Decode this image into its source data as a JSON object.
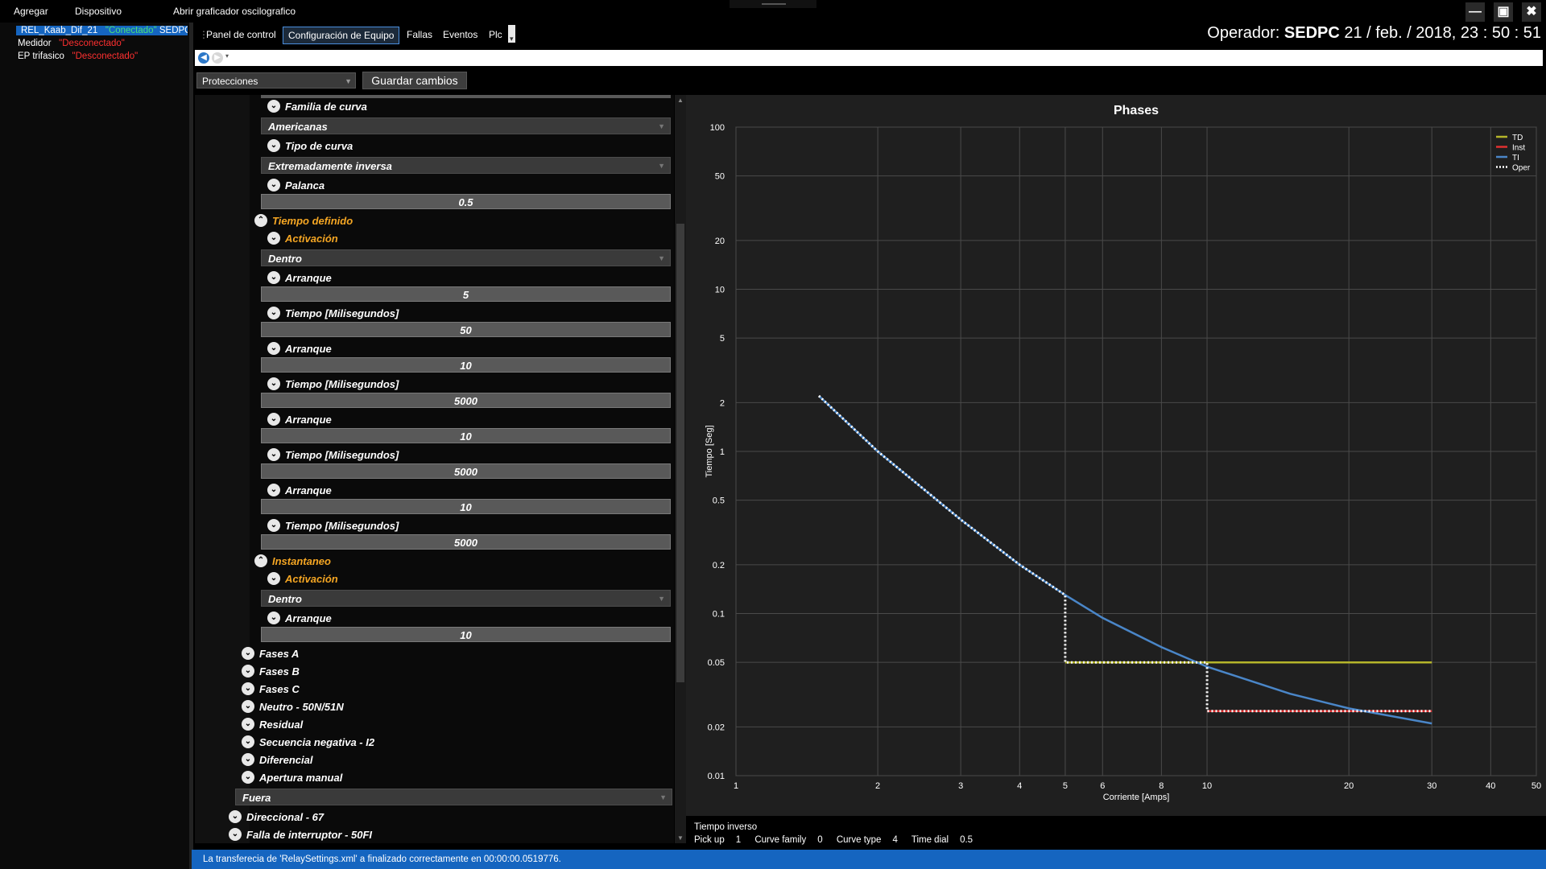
{
  "menu": {
    "items": [
      "Agregar",
      "Dispositivo",
      "Abrir graficador oscilografico"
    ]
  },
  "window_controls": {
    "minimize": "—",
    "maximize": "▣",
    "close": "✖"
  },
  "devices": [
    {
      "name": "REL_Kaab_Dif_21",
      "status": "\"Conectado\"",
      "extra": "SEDPC",
      "selected": true
    },
    {
      "name": "Medidor",
      "status": "\"Desconectado\"",
      "extra": "",
      "selected": false
    },
    {
      "name": "EP trifasico",
      "status": "\"Desconectado\"",
      "extra": "",
      "selected": false
    }
  ],
  "tabs": [
    {
      "label": "Panel de control",
      "active": false
    },
    {
      "label": "Configuración de Equipo",
      "active": true
    },
    {
      "label": "Fallas",
      "active": false
    },
    {
      "label": "Eventos",
      "active": false
    },
    {
      "label": "Plc",
      "active": false
    }
  ],
  "operator": {
    "label": "Operador:",
    "name": "SEDPC",
    "datetime": "21 / feb. / 2018, 23 : 50 : 51"
  },
  "toolbar": {
    "section_select": "Protecciones",
    "save_label": "Guardar cambios"
  },
  "settings": [
    {
      "type": "header",
      "text": "Familia de curva",
      "indent": 3,
      "orange": false,
      "icon": "chevron-down"
    },
    {
      "type": "combo",
      "value": "Americanas"
    },
    {
      "type": "header",
      "text": "Tipo de curva",
      "indent": 3,
      "orange": false,
      "icon": "chevron-down"
    },
    {
      "type": "combo",
      "value": "Extremadamente inversa"
    },
    {
      "type": "header",
      "text": "Palanca",
      "indent": 3,
      "orange": false,
      "icon": "chevron-down"
    },
    {
      "type": "value",
      "value": "0.5"
    },
    {
      "type": "header",
      "text": "Tiempo definido",
      "indent": 2,
      "orange": true,
      "icon": "chevron-up"
    },
    {
      "type": "header",
      "text": "Activación",
      "indent": 3,
      "orange": true,
      "icon": "chevron-down"
    },
    {
      "type": "combo",
      "value": "Dentro"
    },
    {
      "type": "header",
      "text": "Arranque",
      "indent": 3,
      "orange": false,
      "icon": "chevron-down"
    },
    {
      "type": "value",
      "value": "5"
    },
    {
      "type": "header",
      "text": "Tiempo [Milisegundos]",
      "indent": 3,
      "orange": false,
      "icon": "chevron-down"
    },
    {
      "type": "value",
      "value": "50"
    },
    {
      "type": "header",
      "text": "Arranque",
      "indent": 3,
      "orange": false,
      "icon": "chevron-down"
    },
    {
      "type": "value",
      "value": "10"
    },
    {
      "type": "header",
      "text": "Tiempo [Milisegundos]",
      "indent": 3,
      "orange": false,
      "icon": "chevron-down"
    },
    {
      "type": "value",
      "value": "5000"
    },
    {
      "type": "header",
      "text": "Arranque",
      "indent": 3,
      "orange": false,
      "icon": "chevron-down"
    },
    {
      "type": "value",
      "value": "10"
    },
    {
      "type": "header",
      "text": "Tiempo [Milisegundos]",
      "indent": 3,
      "orange": false,
      "icon": "chevron-down"
    },
    {
      "type": "value",
      "value": "5000"
    },
    {
      "type": "header",
      "text": "Arranque",
      "indent": 3,
      "orange": false,
      "icon": "chevron-down"
    },
    {
      "type": "value",
      "value": "10"
    },
    {
      "type": "header",
      "text": "Tiempo [Milisegundos]",
      "indent": 3,
      "orange": false,
      "icon": "chevron-down"
    },
    {
      "type": "value",
      "value": "5000"
    },
    {
      "type": "header",
      "text": "Instantaneo",
      "indent": 2,
      "orange": true,
      "icon": "chevron-up"
    },
    {
      "type": "header",
      "text": "Activación",
      "indent": 3,
      "orange": true,
      "icon": "chevron-down"
    },
    {
      "type": "combo",
      "value": "Dentro"
    },
    {
      "type": "header",
      "text": "Arranque",
      "indent": 3,
      "orange": false,
      "icon": "chevron-down"
    },
    {
      "type": "value",
      "value": "10"
    },
    {
      "type": "header",
      "text": "Fases A",
      "indent": 1,
      "orange": false,
      "icon": "chevron-down"
    },
    {
      "type": "header",
      "text": "Fases B",
      "indent": 1,
      "orange": false,
      "icon": "chevron-down"
    },
    {
      "type": "header",
      "text": "Fases C",
      "indent": 1,
      "orange": false,
      "icon": "chevron-down"
    },
    {
      "type": "header",
      "text": "Neutro - 50N/51N",
      "indent": 1,
      "orange": false,
      "icon": "chevron-down"
    },
    {
      "type": "header",
      "text": "Residual",
      "indent": 1,
      "orange": false,
      "icon": "chevron-down"
    },
    {
      "type": "header",
      "text": "Secuencia negativa - I2",
      "indent": 1,
      "orange": false,
      "icon": "chevron-down"
    },
    {
      "type": "header",
      "text": "Diferencial",
      "indent": 1,
      "orange": false,
      "icon": "chevron-down"
    },
    {
      "type": "header",
      "text": "Apertura manual",
      "indent": 1,
      "orange": false,
      "icon": "chevron-down"
    },
    {
      "type": "combo-wide",
      "value": "Fuera"
    },
    {
      "type": "header",
      "text": "Direccional - 67",
      "indent": 0,
      "orange": false,
      "icon": "chevron-down"
    },
    {
      "type": "header",
      "text": "Falla de interruptor - 50FI",
      "indent": 0,
      "orange": false,
      "icon": "chevron-down"
    }
  ],
  "chart_data": {
    "type": "line",
    "title": "Phases",
    "xlabel": "Corriente [Amps]",
    "ylabel": "Tiempo [Seg]",
    "xscale": "log",
    "yscale": "log",
    "xlim": [
      1,
      50
    ],
    "ylim": [
      0.01,
      100
    ],
    "xticks": [
      1,
      2,
      3,
      4,
      5,
      6,
      8,
      10,
      20,
      30,
      40,
      50
    ],
    "yticks": [
      0.01,
      0.02,
      0.05,
      0.1,
      0.2,
      0.5,
      1,
      2,
      5,
      10,
      20,
      50,
      100
    ],
    "grid": true,
    "legend_position": "top-right",
    "series": [
      {
        "name": "TD",
        "color": "#b5b52a",
        "style": "solid",
        "x": [
          5,
          10,
          30
        ],
        "y": [
          0.05,
          0.05,
          0.05
        ]
      },
      {
        "name": "Inst",
        "color": "#e03030",
        "style": "solid",
        "x": [
          10,
          30
        ],
        "y": [
          0.025,
          0.025
        ]
      },
      {
        "name": "TI",
        "color": "#4a86c8",
        "style": "solid",
        "x": [
          1.5,
          2,
          3,
          4,
          5,
          6,
          8,
          10,
          15,
          20,
          30
        ],
        "y": [
          2.2,
          1.0,
          0.38,
          0.2,
          0.13,
          0.094,
          0.062,
          0.047,
          0.032,
          0.026,
          0.021
        ]
      },
      {
        "name": "Oper",
        "color": "#ffffff",
        "style": "dotted",
        "x": [
          1.5,
          2,
          3,
          4,
          5,
          5,
          10,
          10,
          30
        ],
        "y": [
          2.2,
          1.0,
          0.38,
          0.2,
          0.13,
          0.05,
          0.05,
          0.025,
          0.025
        ]
      }
    ]
  },
  "chart_info": {
    "curve_label": "Tiempo inverso",
    "pickup_label": "Pick up",
    "pickup": "1",
    "family_label": "Curve family",
    "family": "0",
    "type_label": "Curve type",
    "type": "4",
    "dial_label": "Time dial",
    "dial": "0.5"
  },
  "status": "La transferecia de 'RelaySettings.xml' a finalizado correctamente en 00:00:00.0519776."
}
